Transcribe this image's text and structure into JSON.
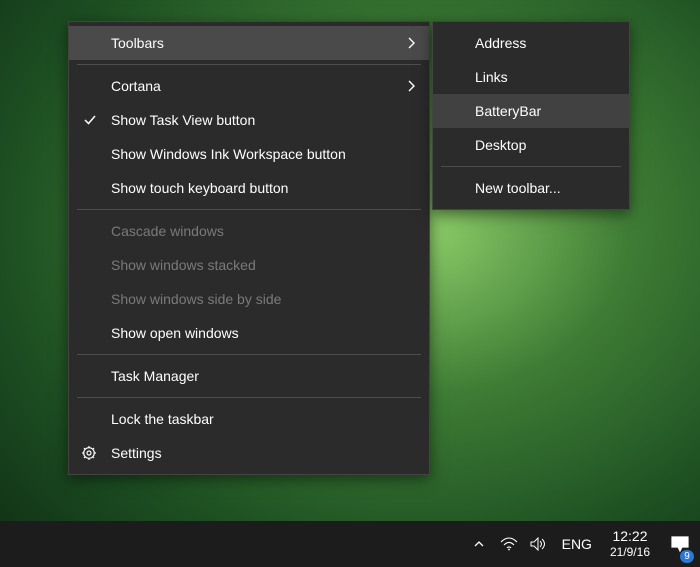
{
  "context_menu": {
    "items": [
      {
        "label": "Toolbars",
        "has_submenu": true,
        "hover": true
      },
      {
        "separator": true
      },
      {
        "label": "Cortana",
        "has_submenu": true
      },
      {
        "label": "Show Task View button",
        "checked": true
      },
      {
        "label": "Show Windows Ink Workspace button"
      },
      {
        "label": "Show touch keyboard button"
      },
      {
        "separator": true
      },
      {
        "label": "Cascade windows",
        "disabled": true
      },
      {
        "label": "Show windows stacked",
        "disabled": true
      },
      {
        "label": "Show windows side by side",
        "disabled": true
      },
      {
        "label": "Show open windows"
      },
      {
        "separator": true
      },
      {
        "label": "Task Manager"
      },
      {
        "separator": true
      },
      {
        "label": "Lock the taskbar"
      },
      {
        "label": "Settings",
        "icon": "gear"
      }
    ]
  },
  "submenu": {
    "items": [
      {
        "label": "Address"
      },
      {
        "label": "Links"
      },
      {
        "label": "BatteryBar",
        "hover": true
      },
      {
        "label": "Desktop"
      },
      {
        "separator": true
      },
      {
        "label": "New toolbar..."
      }
    ]
  },
  "taskbar": {
    "lang": "ENG",
    "time": "12:22",
    "date": "21/9/16",
    "notifications": "9"
  }
}
